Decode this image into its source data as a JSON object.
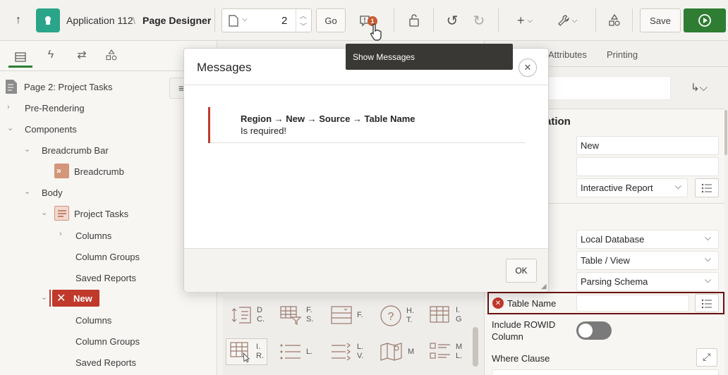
{
  "toolbar": {
    "app_name": "Application 112",
    "separator": "\\",
    "page_designer": "Page Designer",
    "page_number": "2",
    "go_label": "Go",
    "messages_count": "1",
    "save_label": "Save"
  },
  "tooltip": {
    "text": "Show Messages"
  },
  "left_panel": {
    "page_label": "Page 2: Project Tasks",
    "tree": {
      "pre_rendering": "Pre-Rendering",
      "components": "Components",
      "breadcrumb_bar": "Breadcrumb Bar",
      "breadcrumb": "Breadcrumb",
      "body": "Body",
      "project_tasks": "Project Tasks",
      "columns": "Columns",
      "column_groups": "Column Groups",
      "saved_reports": "Saved Reports",
      "new_region": "New",
      "columns_2": "Columns",
      "column_groups_2": "Column Groups",
      "saved_reports_2": "Saved Reports"
    }
  },
  "right_panel": {
    "tabs": {
      "attributes": "Attributes",
      "printing": "Printing"
    },
    "section_title": "ation",
    "title_value": "New",
    "type_value": "Interactive Report",
    "location_value": "Local Database",
    "type2_value": "Table / View",
    "owner_value": "Parsing Schema",
    "table_name_label": "Table Name",
    "rowid_label_line1": "Include ROWID",
    "rowid_label_line2": "Column",
    "where_clause_label": "Where Clause"
  },
  "gallery": {
    "items": [
      {
        "l1": "D",
        "l2": "C."
      },
      {
        "l1": "F.",
        "l2": "S."
      },
      {
        "l1": "F.",
        "l2": ""
      },
      {
        "l1": "H.",
        "l2": "T."
      },
      {
        "l1": "I.",
        "l2": "G"
      },
      {
        "l1": "I.",
        "l2": "R."
      },
      {
        "l1": "L.",
        "l2": ""
      },
      {
        "l1": "L.",
        "l2": "V."
      },
      {
        "l1": "M",
        "l2": ""
      },
      {
        "l1": "M",
        "l2": "L."
      }
    ]
  },
  "modal": {
    "title": "Messages",
    "message_path": "Region → New → Source → Table Name",
    "message_text": "Is required!",
    "ok_label": "OK"
  },
  "colors": {
    "accent_green": "#2e7d32",
    "error_red": "#c0392b",
    "focus_border": "#6b0f0f",
    "app_icon": "#2aa58a"
  }
}
